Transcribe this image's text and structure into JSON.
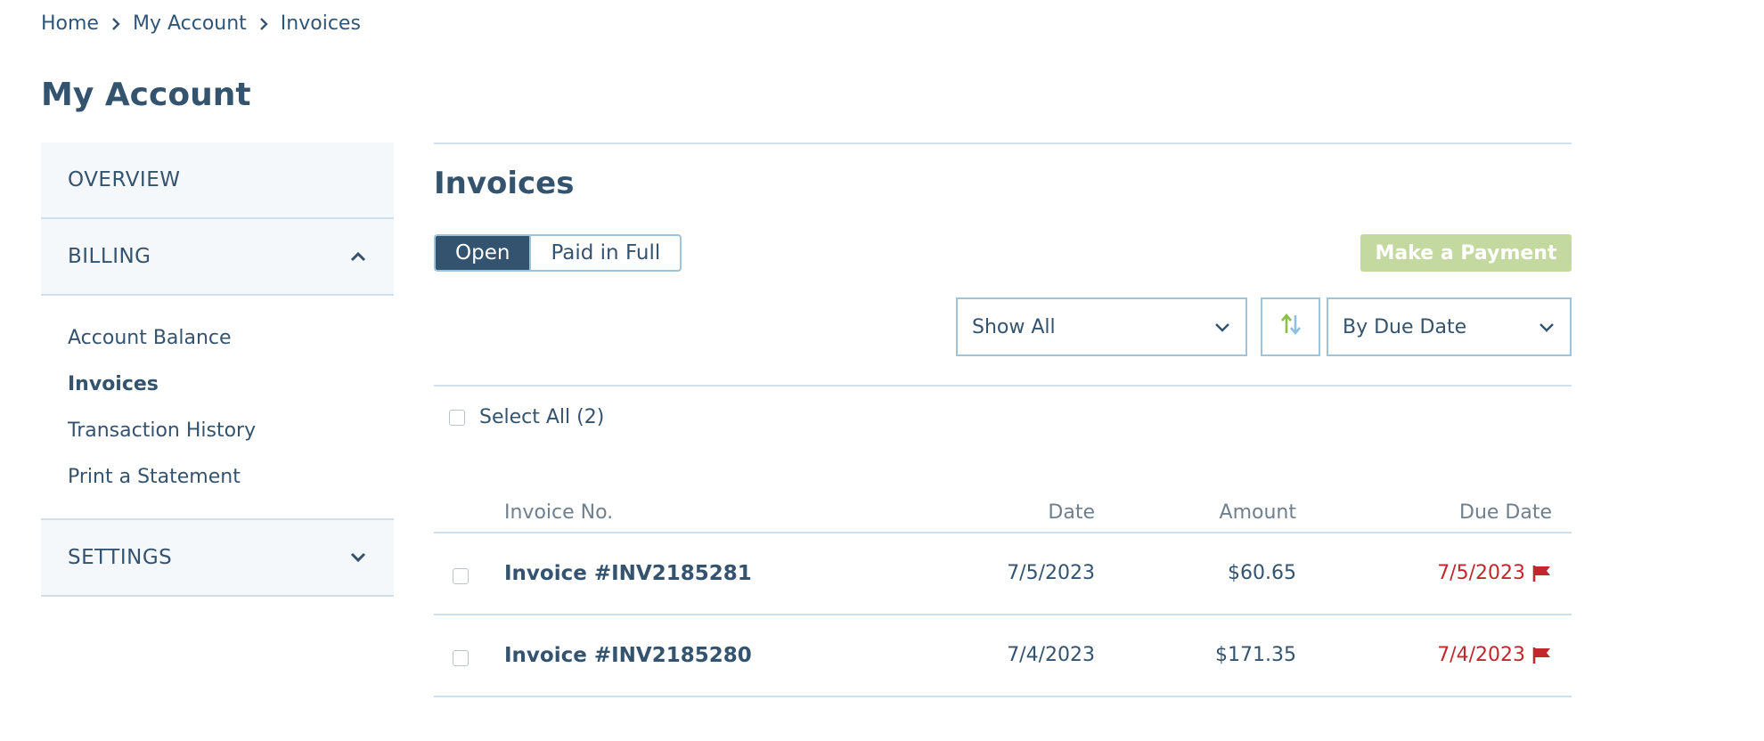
{
  "breadcrumb": [
    "Home",
    "My Account",
    "Invoices"
  ],
  "page_title": "My Account",
  "sidebar": {
    "overview": "OVERVIEW",
    "billing": "BILLING",
    "billing_items": [
      "Account Balance",
      "Invoices",
      "Transaction History",
      "Print a Statement"
    ],
    "active_item": "Invoices",
    "settings": "SETTINGS"
  },
  "main": {
    "title": "Invoices",
    "tabs": [
      "Open",
      "Paid in Full"
    ],
    "active_tab": "Open",
    "pay_button": "Make a Payment",
    "filter_value": "Show All",
    "sort_value": "By Due Date",
    "select_all": "Select All (2)"
  },
  "table": {
    "columns": [
      "Invoice No.",
      "Date",
      "Amount",
      "Due Date"
    ],
    "rows": [
      {
        "invoice": "Invoice #INV2185281",
        "date": "7/5/2023",
        "amount": "$60.65",
        "due": "7/5/2023"
      },
      {
        "invoice": "Invoice #INV2185280",
        "date": "7/4/2023",
        "amount": "$171.35",
        "due": "7/4/2023"
      }
    ]
  },
  "colors": {
    "primary": "#34536f",
    "border": "#cfe0ec",
    "pay_button": "#c3d9a0",
    "overdue": "#c0282d",
    "sort_up": "#8bbf4a",
    "sort_down": "#8fc0e0"
  },
  "icons": [
    "chevron-right-icon",
    "chevron-up-icon",
    "chevron-down-icon",
    "sort-icon",
    "flag-icon"
  ]
}
